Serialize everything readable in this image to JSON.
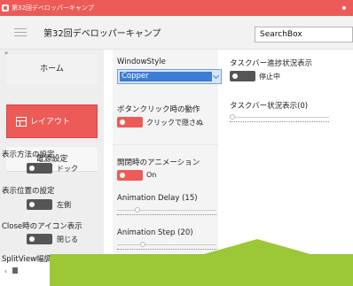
{
  "window": {
    "title": "第32回デベロッパーキャンプ"
  },
  "header": {
    "title": "第32回デベロッパーキャンプ",
    "search_value": "SearchBox"
  },
  "sidebar": {
    "collapse_glyph": "»",
    "items": [
      {
        "label": "ホーム"
      },
      {
        "label": "レイアウト"
      },
      {
        "label": "電源設定"
      }
    ],
    "settings": [
      {
        "label": "表示方法の設定",
        "toggle_label": "ドック",
        "on": false
      },
      {
        "label": "表示位置の設定",
        "toggle_label": "左側",
        "on": false
      },
      {
        "label": "Close時のアイコン表示",
        "toggle_label": "閉じる",
        "on": false
      },
      {
        "label": "SplitView幅調整"
      }
    ]
  },
  "content": {
    "window_style": {
      "label": "WindowStyle",
      "value": "Copper"
    },
    "button_click": {
      "label": "ボタンクリック時の動作",
      "toggle_label": "クリックで隠さぬ",
      "on": true
    },
    "open_anim": {
      "label": "開閉時のアニメーション",
      "toggle_label": "On",
      "on": true
    },
    "anim_delay": {
      "label": "Animation Delay (15)",
      "value": 15
    },
    "anim_step": {
      "label": "Animation Step (20)",
      "value": 20
    },
    "taskbar_progress": {
      "label": "タスクバー進捗状況表示",
      "toggle_label": "停止中",
      "on": false
    },
    "taskbar_state": {
      "label": "タスクバー状況表示(0)",
      "value": 0
    }
  },
  "colors": {
    "accent": "#ec5b57",
    "banner": "#9cc736"
  },
  "icons": {
    "app": "app-icon",
    "menu": "hamburger-icon",
    "layout": "layout-icon"
  }
}
